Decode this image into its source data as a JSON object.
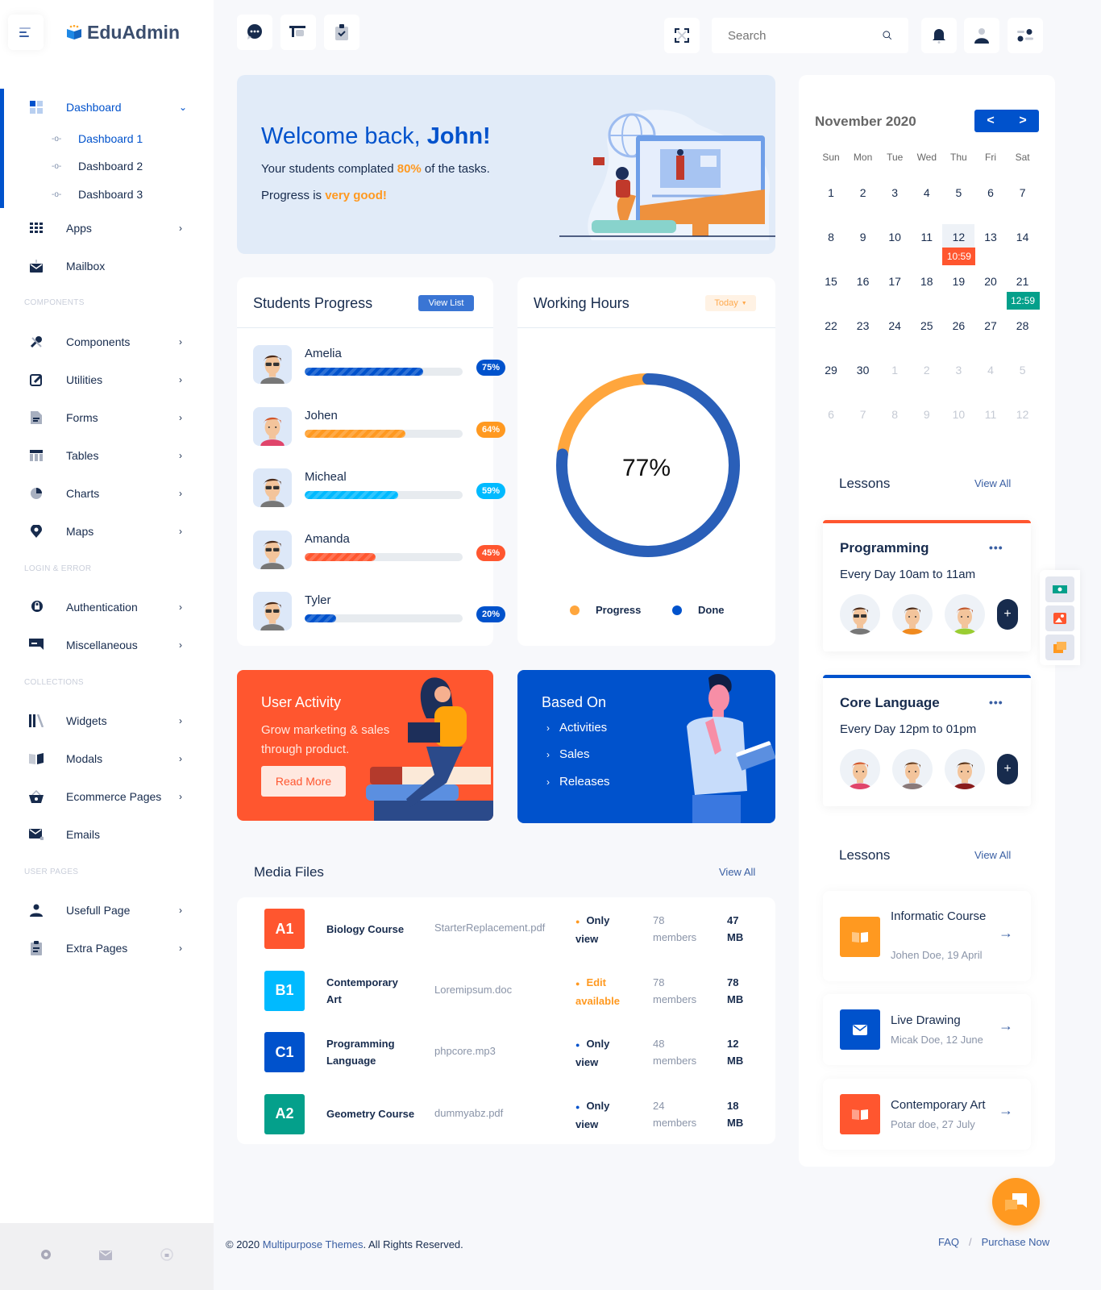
{
  "app": {
    "name": "EduAdmin"
  },
  "sidebar": {
    "dashboard": {
      "label": "Dashboard",
      "sub": [
        "Dashboard 1",
        "Dashboard 2",
        "Dashboard 3"
      ]
    },
    "items_main": [
      {
        "label": "Apps",
        "icon": "apps-grid-icon"
      },
      {
        "label": "Mailbox",
        "icon": "mailbox-icon"
      }
    ],
    "section_components": "COMPONENTS",
    "items_components": [
      {
        "label": "Components",
        "icon": "tools-icon"
      },
      {
        "label": "Utilities",
        "icon": "edit-icon"
      },
      {
        "label": "Forms",
        "icon": "form-icon"
      },
      {
        "label": "Tables",
        "icon": "table-icon"
      },
      {
        "label": "Charts",
        "icon": "pie-chart-icon"
      },
      {
        "label": "Maps",
        "icon": "map-pin-icon"
      }
    ],
    "section_login": "LOGIN & ERROR",
    "items_login": [
      {
        "label": "Authentication",
        "icon": "lock-icon"
      },
      {
        "label": "Miscellaneous",
        "icon": "misc-icon"
      }
    ],
    "section_collections": "COLLECTIONS",
    "items_collections": [
      {
        "label": "Widgets",
        "icon": "library-icon"
      },
      {
        "label": "Modals",
        "icon": "book-icon"
      },
      {
        "label": "Ecommerce Pages",
        "icon": "basket-icon"
      },
      {
        "label": "Emails",
        "icon": "email-icon"
      }
    ],
    "section_user": "USER PAGES",
    "items_user": [
      {
        "label": "Usefull Page",
        "icon": "user-icon"
      },
      {
        "label": "Extra Pages",
        "icon": "clipboard-icon"
      }
    ]
  },
  "topbar": {
    "search_placeholder": "Search"
  },
  "welcome": {
    "greeting": "Welcome back, ",
    "name": "John!",
    "line1_pre": "Your students complated ",
    "line1_value": "80%",
    "line1_post": " of the tasks.",
    "line2_pre": "Progress is ",
    "line2_value": "very good!"
  },
  "students_progress": {
    "title": "Students Progress",
    "button": "View List",
    "students": [
      {
        "name": "Amelia",
        "percent": 75,
        "label": "75%",
        "color": "#0052cc"
      },
      {
        "name": "Johen",
        "percent": 64,
        "label": "64%",
        "color": "#ff9920"
      },
      {
        "name": "Micheal",
        "percent": 59,
        "label": "59%",
        "color": "#00baff"
      },
      {
        "name": "Amanda",
        "percent": 45,
        "label": "45%",
        "color": "#ff562f"
      },
      {
        "name": "Tyler",
        "percent": 20,
        "label": "20%",
        "color": "#0052cc"
      }
    ]
  },
  "working_hours": {
    "title": "Working Hours",
    "filter": "Today",
    "center_label": "77%",
    "legend": [
      {
        "label": "Progress",
        "color": "#ffa63d"
      },
      {
        "label": "Done",
        "color": "#0052cc"
      }
    ]
  },
  "chart_data": {
    "type": "pie",
    "title": "Working Hours",
    "categories": [
      "Progress",
      "Done"
    ],
    "values": [
      23,
      77
    ],
    "colors": [
      "#ffa63d",
      "#2a5fb8"
    ],
    "center_label": "77%"
  },
  "user_activity": {
    "title": "User Activity",
    "text_line1": "Grow marketing & sales",
    "text_line2": "through product.",
    "button": "Read More"
  },
  "based_on": {
    "title": "Based On",
    "items": [
      "Activities",
      "Sales",
      "Releases"
    ]
  },
  "media_files": {
    "title": "Media Files",
    "view_all": "View All",
    "rows": [
      {
        "code": "A1",
        "color": "#ff562f",
        "name": "Biology Course",
        "file": "StarterReplacement.pdf",
        "perm_line1": "Only",
        "perm_line2": "view",
        "perm_color": "#172b4d",
        "dot_color": "#ff9920",
        "members_count": "78",
        "members_label": "members",
        "size_value": "47",
        "size_unit": "MB"
      },
      {
        "code": "B1",
        "color": "#00baff",
        "name": "Contemporary Art",
        "file": "Loremipsum.doc",
        "perm_line1": "Edit",
        "perm_line2": "available",
        "perm_color": "#ff9920",
        "dot_color": "#ff9920",
        "members_count": "78",
        "members_label": "members",
        "size_value": "78",
        "size_unit": "MB"
      },
      {
        "code": "C1",
        "color": "#0052cc",
        "name": "Programming Language",
        "file": "phpcore.mp3",
        "perm_line1": "Only",
        "perm_line2": "view",
        "perm_color": "#172b4d",
        "dot_color": "#0052cc",
        "members_count": "48",
        "members_label": "members",
        "size_value": "12",
        "size_unit": "MB"
      },
      {
        "code": "A2",
        "color": "#04a08b",
        "name": "Geometry Course",
        "file": "dummyabz.pdf",
        "perm_line1": "Only",
        "perm_line2": "view",
        "perm_color": "#172b4d",
        "dot_color": "#0052cc",
        "members_count": "24",
        "members_label": "members",
        "size_value": "18",
        "size_unit": "MB"
      }
    ]
  },
  "calendar": {
    "title": "November 2020",
    "prev": "<",
    "next": ">",
    "dow": [
      "Sun",
      "Mon",
      "Tue",
      "Wed",
      "Thu",
      "Fri",
      "Sat"
    ],
    "weeks": [
      [
        "1",
        "2",
        "3",
        "4",
        "5",
        "6",
        "7"
      ],
      [
        "8",
        "9",
        "10",
        "11",
        "12",
        "13",
        "14"
      ],
      [
        "15",
        "16",
        "17",
        "18",
        "19",
        "20",
        "21"
      ],
      [
        "22",
        "23",
        "24",
        "25",
        "26",
        "27",
        "28"
      ],
      [
        "29",
        "30",
        "1",
        "2",
        "3",
        "4",
        "5"
      ],
      [
        "6",
        "7",
        "8",
        "9",
        "10",
        "11",
        "12"
      ]
    ],
    "today": "12",
    "events": [
      {
        "day": "12",
        "label": "10:59",
        "color": "#ff562f"
      },
      {
        "day": "21",
        "label": "12:59",
        "color": "#04a08b"
      }
    ]
  },
  "lessons_top": {
    "title": "Lessons",
    "view_all": "View All",
    "cards": [
      {
        "title": "Programming",
        "time": "Every Day 10am to 11am",
        "accent": "#ff562f",
        "more": "•••",
        "add": "+"
      },
      {
        "title": "Core Language",
        "time": "Every Day 12pm to 01pm",
        "accent": "#0052cc",
        "more": "•••",
        "add": "+"
      }
    ]
  },
  "lessons_list": {
    "title": "Lessons",
    "view_all": "View All",
    "items": [
      {
        "title": "Informatic Course",
        "sub": "Johen Doe, 19 April",
        "color": "#ff9920",
        "icon": "book-open-icon"
      },
      {
        "title": "Live Drawing",
        "sub": "Micak Doe, 12 June",
        "color": "#0052cc",
        "icon": "envelope-icon"
      },
      {
        "title": "Contemporary Art",
        "sub": "Potar doe, 27 July",
        "color": "#ff562f",
        "icon": "book-open-icon"
      }
    ]
  },
  "footer": {
    "copyright_pre": "© 2020 ",
    "copyright_link": "Multipurpose Themes",
    "copyright_post": ". All Rights Reserved.",
    "faq": "FAQ",
    "sep": "/",
    "purchase": "Purchase Now"
  }
}
